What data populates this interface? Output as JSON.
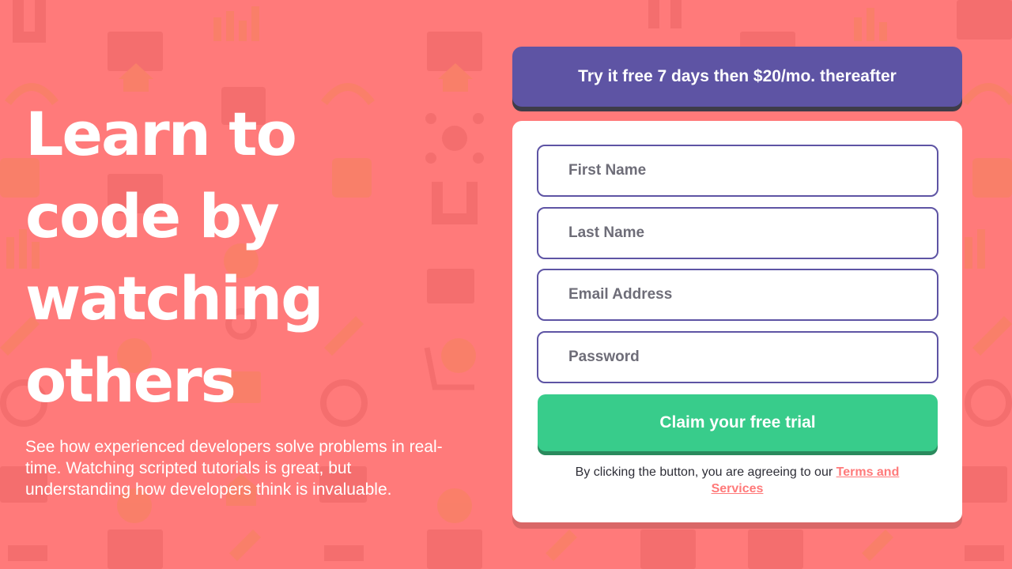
{
  "colors": {
    "background": "#ff7a7a",
    "promo_bg": "#5e54a4",
    "button_bg": "#38cc8b",
    "field_border": "#5e54a4",
    "link": "#ff7a7a"
  },
  "hero": {
    "title_lines": [
      "Learn to",
      "code by",
      "watching",
      "others"
    ],
    "subtitle": "See how experienced developers solve problems in real-time. Watching scripted tutorials is great, but understanding how developers think is invaluable."
  },
  "promo": {
    "text": "Try it free 7 days then $20/mo. thereafter"
  },
  "form": {
    "fields": [
      {
        "placeholder": "First Name",
        "value": ""
      },
      {
        "placeholder": "Last Name",
        "value": ""
      },
      {
        "placeholder": "Email Address",
        "value": ""
      },
      {
        "placeholder": "Password",
        "value": ""
      }
    ],
    "submit_label": "Claim your free trial",
    "terms_prefix": "By clicking the button, you are agreeing to our ",
    "terms_link": "Terms and Services"
  },
  "background_icons": [
    "magnet-icon",
    "bar-chart-icon",
    "browser-window-icon",
    "home-icon",
    "headset-icon",
    "network-icon",
    "thumbs-up-icon",
    "rocket-icon",
    "lightbulb-icon",
    "shopping-cart-icon",
    "gear-icon",
    "pencil-icon",
    "search-icon",
    "sitemap-icon"
  ]
}
